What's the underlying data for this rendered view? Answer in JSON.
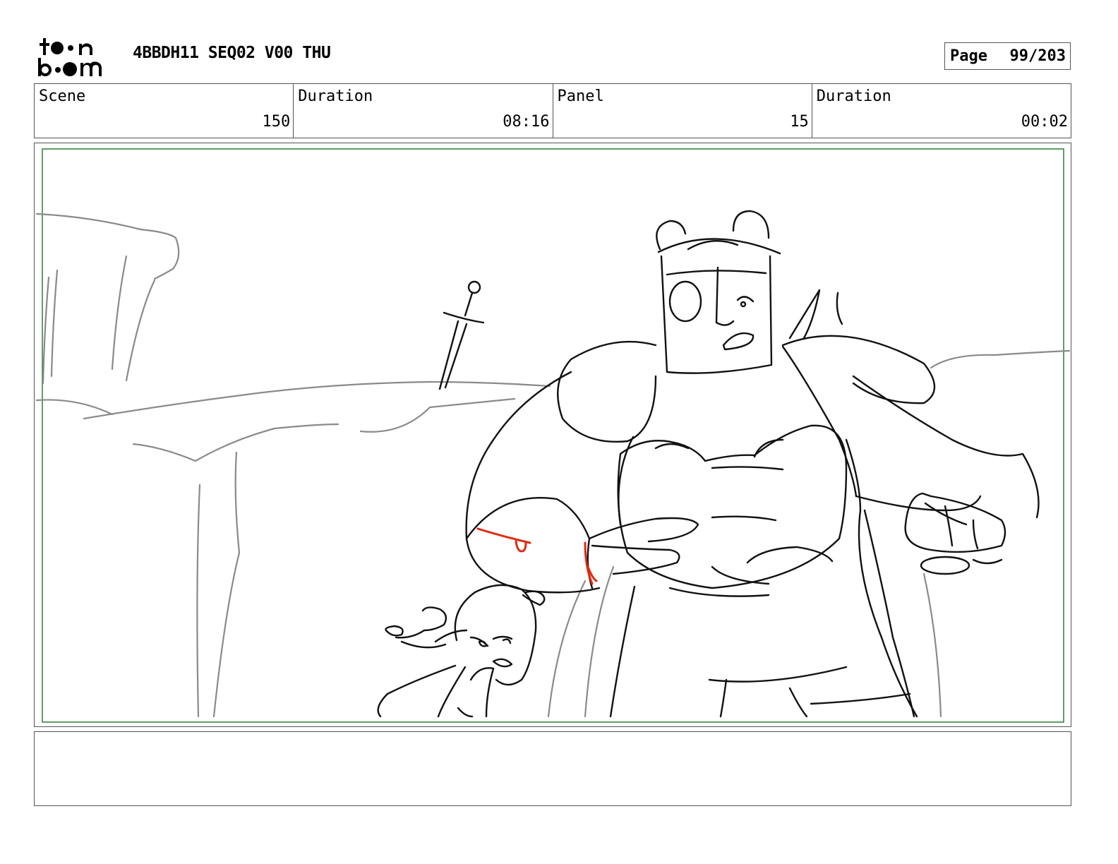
{
  "header": {
    "logo": {
      "line1": "toon",
      "line2": "boom",
      "icon": "toon-boom-logo"
    },
    "title": "4BBDH11 SEQ02 V00 THU",
    "page_label": "Page",
    "page_value": "99/203"
  },
  "info": [
    {
      "label": "Scene",
      "value": "150"
    },
    {
      "label": "Duration",
      "value": "08:16"
    },
    {
      "label": "Panel",
      "value": "15"
    },
    {
      "label": "Duration",
      "value": "00:02"
    }
  ],
  "panel": {
    "drawing": "storyboard-sketch",
    "safe_frame_color": "#2e7d32",
    "line_color": "#111111",
    "background_line_color": "#8a8a8a",
    "accent_color": "#e02a10"
  },
  "notes": {
    "text": ""
  }
}
